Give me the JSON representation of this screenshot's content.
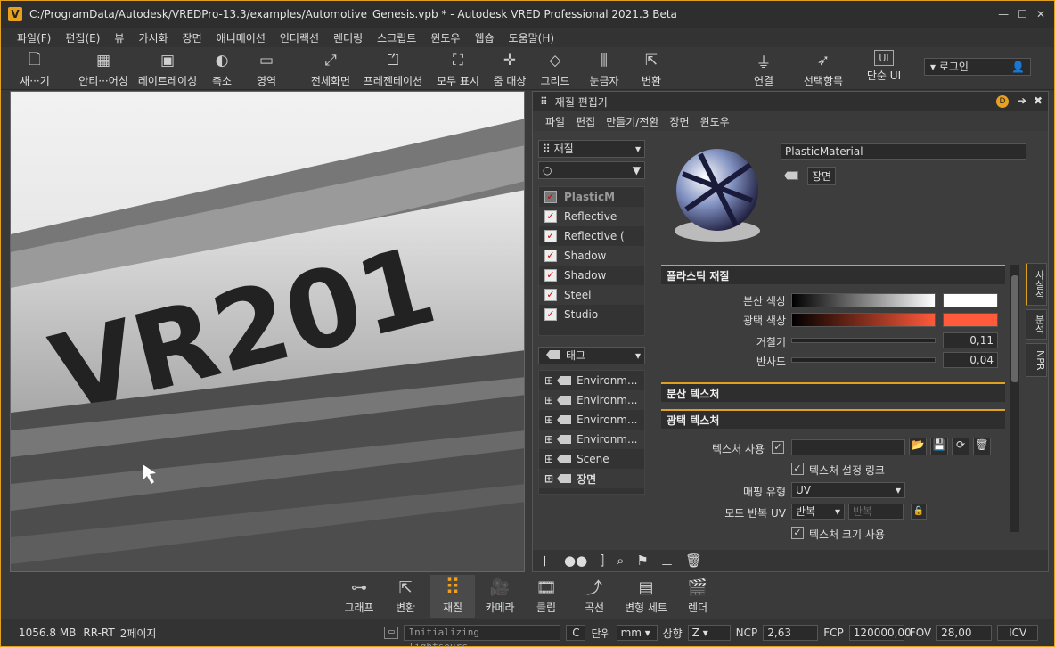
{
  "window": {
    "title": "C:/ProgramData/Autodesk/VREDPro-13.3/examples/Automotive_Genesis.vpb * - Autodesk VRED Professional 2021.3 Beta",
    "min": "—",
    "max": "☐",
    "close": "✕"
  },
  "menu": [
    "파일(F)",
    "편집(E)",
    "뷰",
    "가시화",
    "장면",
    "애니메이션",
    "인터랙션",
    "렌더링",
    "스크립트",
    "윈도우",
    "웹숍",
    "도움말(H)"
  ],
  "toolbar": [
    {
      "label": "새···기",
      "icon": "page-icon",
      "glyph": "🗋"
    },
    {
      "label": "안티···어싱",
      "icon": "grid-icon",
      "glyph": "▦"
    },
    {
      "label": "레이트레이싱",
      "icon": "cpu-icon",
      "glyph": "▣"
    },
    {
      "label": "축소",
      "icon": "half-circle-icon",
      "glyph": "◐"
    },
    {
      "label": "영역",
      "icon": "region-icon",
      "glyph": "▭"
    },
    {
      "label": "전체화면",
      "icon": "fullscreen-icon",
      "glyph": "⤢"
    },
    {
      "label": "프레젠테이션",
      "icon": "presentation-icon",
      "glyph": "⏍"
    },
    {
      "label": "모두 표시",
      "icon": "fit-all-icon",
      "glyph": "⛶"
    },
    {
      "label": "줌 대상",
      "icon": "zoom-target-icon",
      "glyph": "✛"
    },
    {
      "label": "그리드",
      "icon": "grid-plane-icon",
      "glyph": "◇"
    },
    {
      "label": "눈금자",
      "icon": "ruler-icon",
      "glyph": "⫼"
    },
    {
      "label": "변환",
      "icon": "transform-icon",
      "glyph": "⇱"
    },
    {
      "label": "연결",
      "icon": "plug-icon",
      "glyph": "⏚"
    },
    {
      "label": "선택항목",
      "icon": "select-icon",
      "glyph": "➶"
    },
    {
      "label": "단순 UI",
      "icon": "ui-icon",
      "glyph": "UI"
    }
  ],
  "login": "로그인",
  "viewport": {
    "plate": "VR201"
  },
  "panel": {
    "title": "재질 편집기",
    "menu": [
      "파일",
      "편집",
      "만들기/전환",
      "장면",
      "윈도우"
    ],
    "material_dd": "재질",
    "material_tree": [
      "PlasticM",
      "Reflective",
      "Reflective (",
      "Shadow",
      "Shadow",
      "Steel",
      "Studio"
    ],
    "tag_dd": "태그",
    "tag_tree": [
      "Environm...",
      "Environm...",
      "Environm...",
      "Environm...",
      "Scene",
      "장면"
    ],
    "material_name": "PlasticMaterial",
    "scene_btn": "장면",
    "sections": {
      "plastic": "플라스틱 재질",
      "diffuse_tex": "분산 텍스처",
      "gloss_tex": "광택 텍스처"
    },
    "props": {
      "diffuse": "분산 색상",
      "gloss": "광택 색상",
      "roughness": "거칠기",
      "roughness_val": "0,11",
      "reflect": "반사도",
      "reflect_val": "0,04"
    },
    "tex": {
      "use": "텍스처 사용",
      "link": "텍스처 설정 링크",
      "mapping": "매핑 유형",
      "mapping_val": "UV",
      "repeat": "모드 반복 UV",
      "repeat_val": "반복",
      "repeat_val2": "반복",
      "size": "텍스처 크기 사용"
    },
    "side_tabs": [
      "사실적",
      "분석",
      "NPR"
    ]
  },
  "dock": [
    {
      "label": "그래프",
      "icon": "graph-icon",
      "glyph": "⊶"
    },
    {
      "label": "변환",
      "icon": "transform-icon",
      "glyph": "⇱"
    },
    {
      "label": "재질",
      "icon": "material-icon",
      "glyph": "⠿"
    },
    {
      "label": "카메라",
      "icon": "camera-icon",
      "glyph": "🎥"
    },
    {
      "label": "클립",
      "icon": "clip-icon",
      "glyph": "🎞"
    },
    {
      "label": "곡선",
      "icon": "curve-icon",
      "glyph": "⤴"
    },
    {
      "label": "변형 세트",
      "icon": "variant-set-icon",
      "glyph": "▤"
    },
    {
      "label": "렌더",
      "icon": "render-icon",
      "glyph": "🎬"
    }
  ],
  "status": {
    "mem": "1056.8 MB",
    "mode": "RR-RT",
    "pages": "2페이지",
    "msg": "Initializing lightsourc...",
    "c": "C",
    "unit_label": "단위",
    "unit": "mm",
    "up_label": "상향",
    "up": "Z",
    "ncp_label": "NCP",
    "ncp": "2,63",
    "fcp_label": "FCP",
    "fcp": "120000,00",
    "fov_label": "FOV",
    "fov": "28,00",
    "icv": "ICV"
  }
}
